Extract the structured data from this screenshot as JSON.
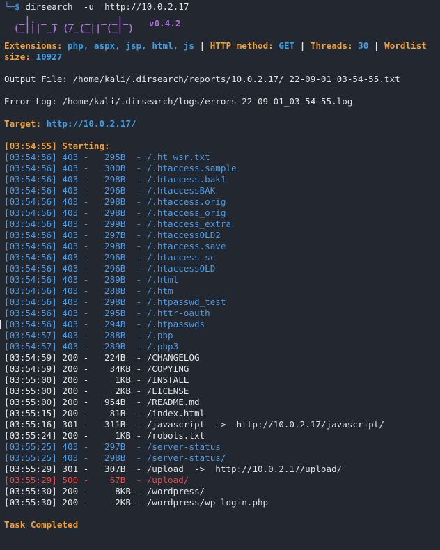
{
  "prompt": {
    "corner": "└─",
    "dollar": "$",
    "command": "dirsearch  -u  http://10.0.2.17"
  },
  "banner": {
    "art_line1": "  _|. _ _  _  _  _ _|_",
    "art_line2": " (_||| _) (/_(_|| (_| )",
    "version": "v0.4.2"
  },
  "config": {
    "extensions_label": "Extensions:",
    "extensions_value": "php, aspx, jsp, html, js",
    "method_label": "HTTP method:",
    "method_value": "GET",
    "threads_label": "Threads:",
    "threads_value": "30",
    "wordlist_label": "Wordlist size:",
    "wordlist_value": "10927",
    "separator": "|"
  },
  "output_file": "Output File: /home/kali/.dirsearch/reports/10.0.2.17/_22-09-01_03-54-55.txt",
  "error_log": "Error Log: /home/kali/.dirsearch/logs/errors-22-09-01_03-54-55.log",
  "target": {
    "label": "Target:",
    "value": "http://10.0.2.17/"
  },
  "starting": "[03:54:55] Starting:",
  "results": [
    {
      "text": "[03:54:56] 403 -   295B  - /.ht_wsr.txt",
      "color": "blue"
    },
    {
      "text": "[03:54:56] 403 -   300B  - /.htaccess.sample",
      "color": "blue"
    },
    {
      "text": "[03:54:56] 403 -   298B  - /.htaccess.bak1",
      "color": "blue"
    },
    {
      "text": "[03:54:56] 403 -   296B  - /.htaccessBAK",
      "color": "blue"
    },
    {
      "text": "[03:54:56] 403 -   298B  - /.htaccess.orig",
      "color": "blue"
    },
    {
      "text": "[03:54:56] 403 -   298B  - /.htaccess_orig",
      "color": "blue"
    },
    {
      "text": "[03:54:56] 403 -   299B  - /.htaccess_extra",
      "color": "blue"
    },
    {
      "text": "[03:54:56] 403 -   297B  - /.htaccessOLD2",
      "color": "blue"
    },
    {
      "text": "[03:54:56] 403 -   298B  - /.htaccess.save",
      "color": "blue"
    },
    {
      "text": "[03:54:56] 403 -   296B  - /.htaccess_sc",
      "color": "blue"
    },
    {
      "text": "[03:54:56] 403 -   296B  - /.htaccessOLD",
      "color": "blue"
    },
    {
      "text": "[03:54:56] 403 -   289B  - /.html",
      "color": "blue"
    },
    {
      "text": "[03:54:56] 403 -   288B  - /.htm",
      "color": "blue"
    },
    {
      "text": "[03:54:56] 403 -   298B  - /.htpasswd_test",
      "color": "blue"
    },
    {
      "text": "[03:54:56] 403 -   295B  - /.httr-oauth",
      "color": "blue"
    },
    {
      "text": "[03:54:56] 403 -   294B  - /.htpasswds",
      "color": "blue"
    },
    {
      "text": "[03:54:57] 403 -   288B  - /.php",
      "color": "blue"
    },
    {
      "text": "[03:54:57] 403 -   289B  - /.php3",
      "color": "blue"
    },
    {
      "text": "[03:54:59] 200 -   224B  - /CHANGELOG",
      "color": "white"
    },
    {
      "text": "[03:54:59] 200 -    34KB - /COPYING",
      "color": "white"
    },
    {
      "text": "[03:55:00] 200 -     1KB - /INSTALL",
      "color": "white"
    },
    {
      "text": "[03:55:00] 200 -     2KB - /LICENSE",
      "color": "white"
    },
    {
      "text": "[03:55:00] 200 -   954B  - /README.md",
      "color": "white"
    },
    {
      "text": "[03:55:15] 200 -    81B  - /index.html",
      "color": "white"
    },
    {
      "text": "[03:55:16] 301 -   311B  - /javascript  ->  http://10.0.2.17/javascript/",
      "color": "white"
    },
    {
      "text": "[03:55:24] 200 -     1KB - /robots.txt",
      "color": "white"
    },
    {
      "text": "[03:55:25] 403 -   297B  - /server-status",
      "color": "blue"
    },
    {
      "text": "[03:55:25] 403 -   298B  - /server-status/",
      "color": "blue"
    },
    {
      "text": "[03:55:29] 301 -   307B  - /upload  ->  http://10.0.2.17/upload/",
      "color": "white"
    },
    {
      "text": "[03:55:29] 500 -    67B  - /upload/",
      "color": "red"
    },
    {
      "text": "[03:55:30] 200 -     8KB - /wordpress/",
      "color": "white"
    },
    {
      "text": "[03:55:30] 200 -     2KB - /wordpress/wp-login.php",
      "color": "white"
    }
  ],
  "task_completed": "Task Completed",
  "colors": {
    "background": "#23272f",
    "text": "#dfe2e7",
    "accent_orange": "#f0a035",
    "accent_blue": "#3d9ee6",
    "status_403": "#4a9ae6",
    "status_500": "#e34a4a",
    "banner_purple": "#b06ee0"
  }
}
